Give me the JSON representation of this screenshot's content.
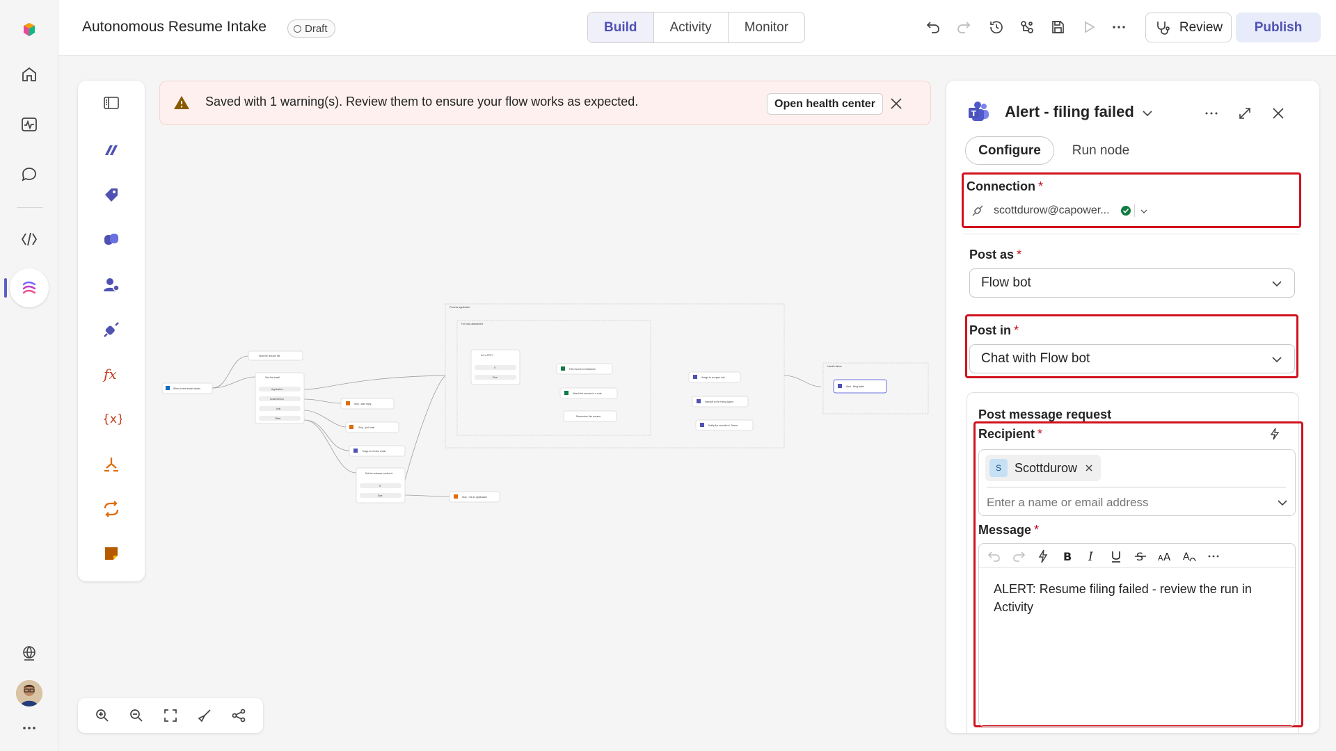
{
  "app": {
    "flow_title": "Autonomous Resume Intake",
    "status_badge": "Draft"
  },
  "header_tabs": [
    {
      "label": "Build",
      "selected": true
    },
    {
      "label": "Activity",
      "selected": false
    },
    {
      "label": "Monitor",
      "selected": false
    }
  ],
  "toolbar": {
    "review_label": "Review",
    "publish_label": "Publish",
    "icons": [
      "undo-icon",
      "redo-icon",
      "history-icon",
      "connections-icon",
      "save-icon",
      "run-icon",
      "more-icon"
    ]
  },
  "left_rail": {
    "items": [
      "home-icon",
      "analytics-icon",
      "chat-icon",
      "code-icon",
      "flows-icon"
    ],
    "bottom": [
      "globe-icon",
      "avatar",
      "more-icon"
    ]
  },
  "tool_panel": {
    "items": [
      "panel-toggle-icon",
      "ai-icon",
      "tag-icon",
      "copilot-icon",
      "people-icon",
      "connector-icon",
      "fx-icon",
      "variable-icon",
      "branch-icon",
      "loop-icon",
      "note-icon"
    ]
  },
  "warning": {
    "message": "Saved with 1 warning(s). Review them to ensure your flow works as expected.",
    "action_label": "Open health center"
  },
  "canvas": {
    "nodes": [
      "When a new email arrives",
      "Start the resume file",
      "Sort the email",
      "Application",
      "ScaDGNGon",
      "Junk",
      "Other",
      "Skip - auto reply",
      "Skip - junk mail",
      "Triage on review email",
      "Did the reviewer confirm it",
      "If",
      "Else",
      "Skip - not an application",
      "Process application",
      "For each attachment",
      "Is it a PDF?",
      "File resume to Dataverse",
      "Attach the resume to a note",
      "Remember this resume",
      "Assign to an open role",
      "Handoff to the Hiring Agent",
      "Notify the recruiter in Teams",
      "Handle failure",
      "Alert - filing failed"
    ]
  },
  "side_panel": {
    "title": "Alert - filing failed",
    "tabs": [
      {
        "label": "Configure",
        "selected": true
      },
      {
        "label": "Run node",
        "selected": false
      }
    ],
    "connection": {
      "label": "Connection",
      "value": "scottdurow@capower..."
    },
    "post_as": {
      "label": "Post as",
      "value": "Flow bot"
    },
    "post_in": {
      "label": "Post in",
      "value": "Chat with Flow bot"
    },
    "post_message_request": {
      "section_label": "Post message request",
      "recipient_label": "Recipient",
      "recipient_chip": {
        "initial": "S",
        "name": "Scottdurow"
      },
      "recipient_placeholder": "Enter a name or email address",
      "message_label": "Message",
      "message_text": "ALERT: Resume filing failed - review the run in Activity"
    }
  },
  "colors": {
    "accent": "#4f52b2",
    "highlight_red": "#d1111e",
    "warning_bg": "#fdf0ee"
  }
}
